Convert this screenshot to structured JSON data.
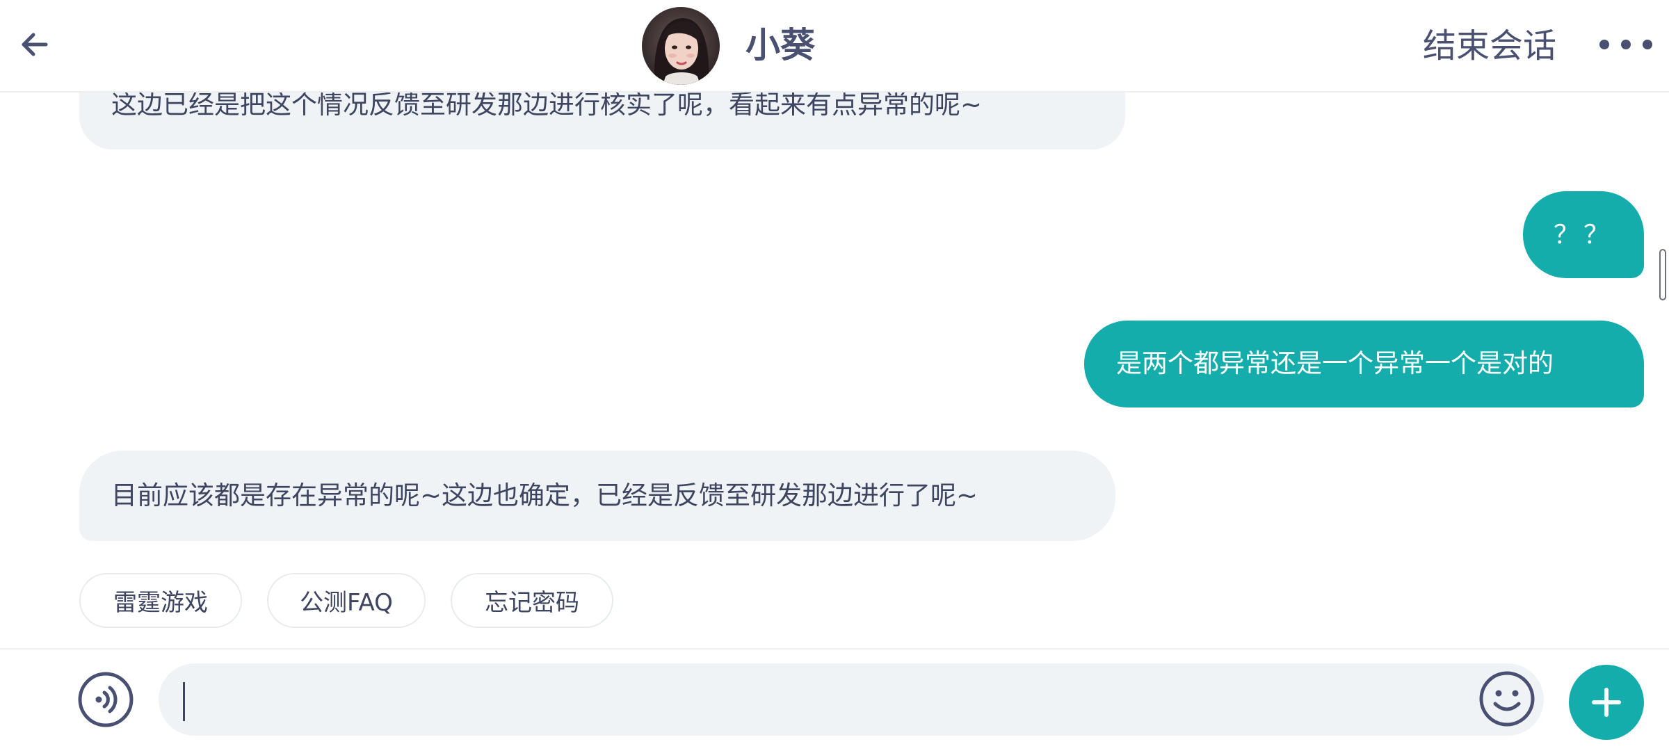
{
  "header": {
    "agent_name": "小葵",
    "end_session_label": "结束会话",
    "back_icon": "arrow-left-icon",
    "more_icon": "more-horizontal-icon"
  },
  "messages": [
    {
      "sender": "agent",
      "text": "这边已经是把这个情况反馈至研发那边进行核实了呢，看起来有点异常的呢~"
    },
    {
      "sender": "user",
      "text": "？？"
    },
    {
      "sender": "user",
      "text": "是两个都异常还是一个异常一个是对的"
    },
    {
      "sender": "agent",
      "text": "目前应该都是存在异常的呢~这边也确定，已经是反馈至研发那边进行了呢~"
    }
  ],
  "quick_replies": [
    "雷霆游戏",
    "公测FAQ",
    "忘记密码"
  ],
  "input": {
    "value": "",
    "placeholder": "",
    "voice_icon": "voice-icon",
    "emoji_icon": "emoji-icon",
    "plus_icon": "plus-icon"
  },
  "colors": {
    "accent": "#14adab",
    "agent_bubble": "#f0f3f6",
    "text_primary": "#3e4560",
    "header_text": "#4a5071"
  }
}
